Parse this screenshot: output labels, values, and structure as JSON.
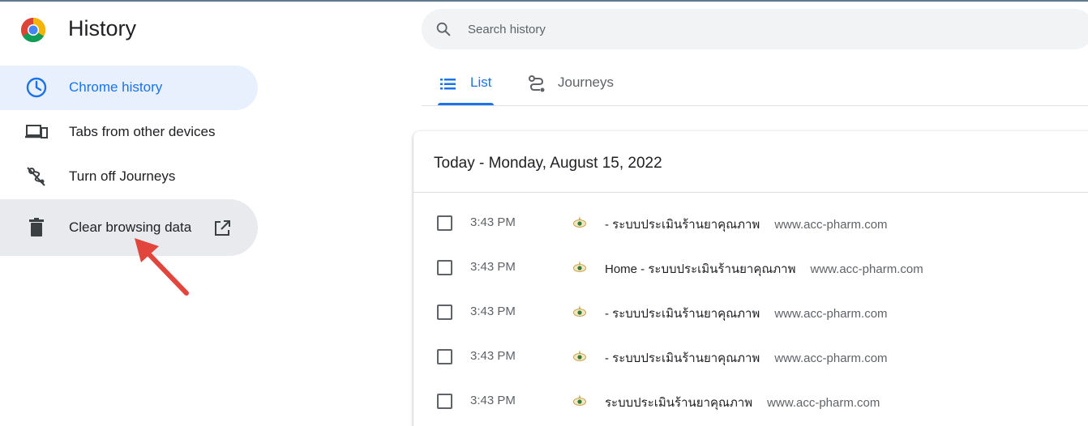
{
  "app": {
    "title": "History"
  },
  "search": {
    "placeholder": "Search history",
    "value": ""
  },
  "sidebar": {
    "items": [
      {
        "label": "Chrome history",
        "icon": "clock-icon",
        "active": true
      },
      {
        "label": "Tabs from other devices",
        "icon": "devices-icon"
      },
      {
        "label": "Turn off Journeys",
        "icon": "journeys-off-icon"
      },
      {
        "label": "Clear browsing data",
        "icon": "trash-icon",
        "trailing_icon": "open-in-new-icon"
      }
    ]
  },
  "tabs": [
    {
      "label": "List",
      "icon": "list-icon",
      "selected": true
    },
    {
      "label": "Journeys",
      "icon": "journeys-icon",
      "selected": false
    }
  ],
  "history": {
    "date_header": "Today - Monday, August 15, 2022",
    "entries": [
      {
        "time": "3:43 PM",
        "title": "- ระบบประเมินร้านยาคุณภาพ",
        "domain": "www.acc-pharm.com",
        "checked": false
      },
      {
        "time": "3:43 PM",
        "title": "Home - ระบบประเมินร้านยาคุณภาพ",
        "domain": "www.acc-pharm.com",
        "checked": false
      },
      {
        "time": "3:43 PM",
        "title": "- ระบบประเมินร้านยาคุณภาพ",
        "domain": "www.acc-pharm.com",
        "checked": false
      },
      {
        "time": "3:43 PM",
        "title": "- ระบบประเมินร้านยาคุณภาพ",
        "domain": "www.acc-pharm.com",
        "checked": false
      },
      {
        "time": "3:43 PM",
        "title": "ระบบประเมินร้านยาคุณภาพ",
        "domain": "www.acc-pharm.com",
        "checked": false
      }
    ]
  },
  "colors": {
    "accent": "#1a73e8",
    "active_nav_bg": "#e8f0fe",
    "hover_nav_bg": "#e8eaed",
    "search_bg": "#f1f3f4",
    "annotation_arrow": "#e2453c"
  }
}
